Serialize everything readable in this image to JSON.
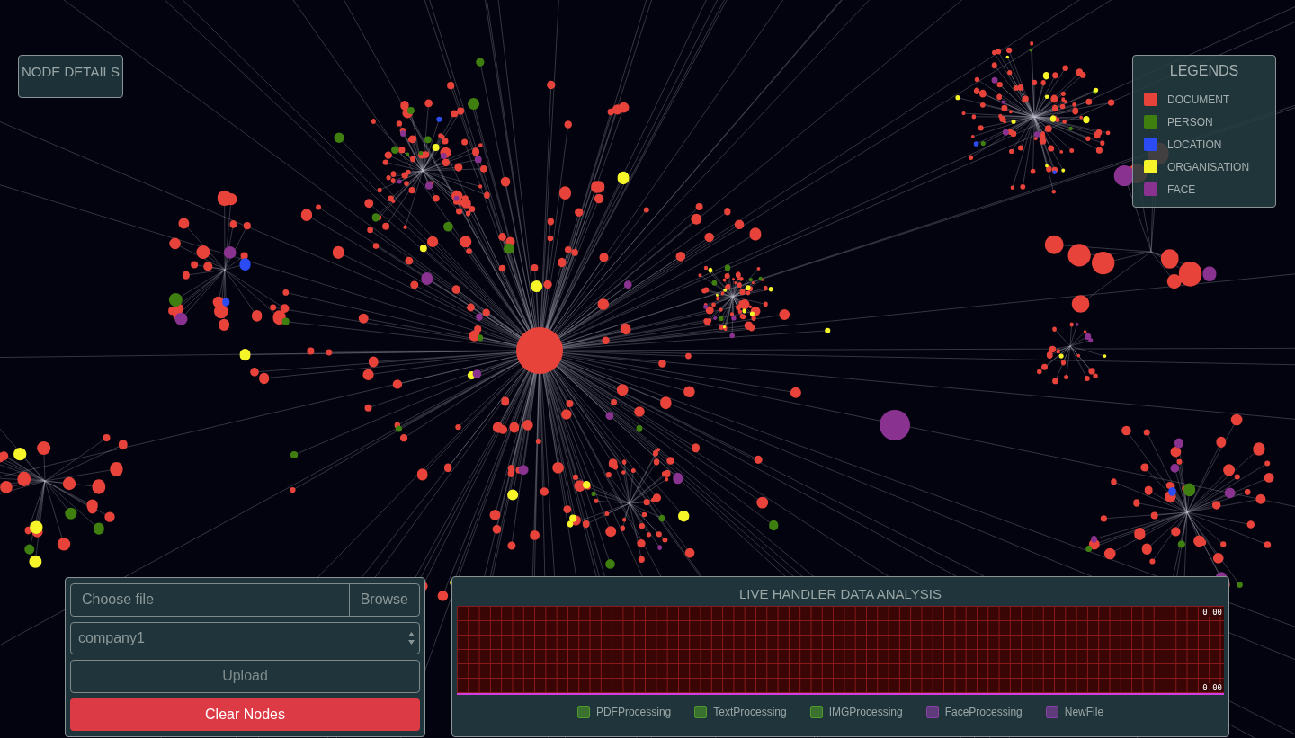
{
  "node_details": {
    "title": "NODE DETAILS"
  },
  "legends": {
    "title": "LEGENDS",
    "items": [
      {
        "label": "DOCUMENT",
        "color": "#e8433a"
      },
      {
        "label": "PERSON",
        "color": "#3f7f10"
      },
      {
        "label": "LOCATION",
        "color": "#2b4cf5"
      },
      {
        "label": "ORGANISATION",
        "color": "#f5f52a"
      },
      {
        "label": "FACE",
        "color": "#8a3290"
      }
    ]
  },
  "upload_panel": {
    "file_field": {
      "placeholder": "Choose file",
      "browse_label": "Browse"
    },
    "dataset_select": {
      "value": "company1"
    },
    "upload_button": "Upload",
    "clear_button": "Clear Nodes"
  },
  "analysis_panel": {
    "title": "LIVE HANDLER DATA ANALYSIS",
    "max_label": "0.00",
    "min_label": "0.00",
    "series": [
      {
        "label": "PDFProcessing",
        "color": "#4f9a2a"
      },
      {
        "label": "TextProcessing",
        "color": "#4f9a2a"
      },
      {
        "label": "IMGProcessing",
        "color": "#4f9a2a"
      },
      {
        "label": "FaceProcessing",
        "color": "#8a3fa6"
      },
      {
        "label": "NewFile",
        "color": "#8a3fa6"
      }
    ]
  }
}
